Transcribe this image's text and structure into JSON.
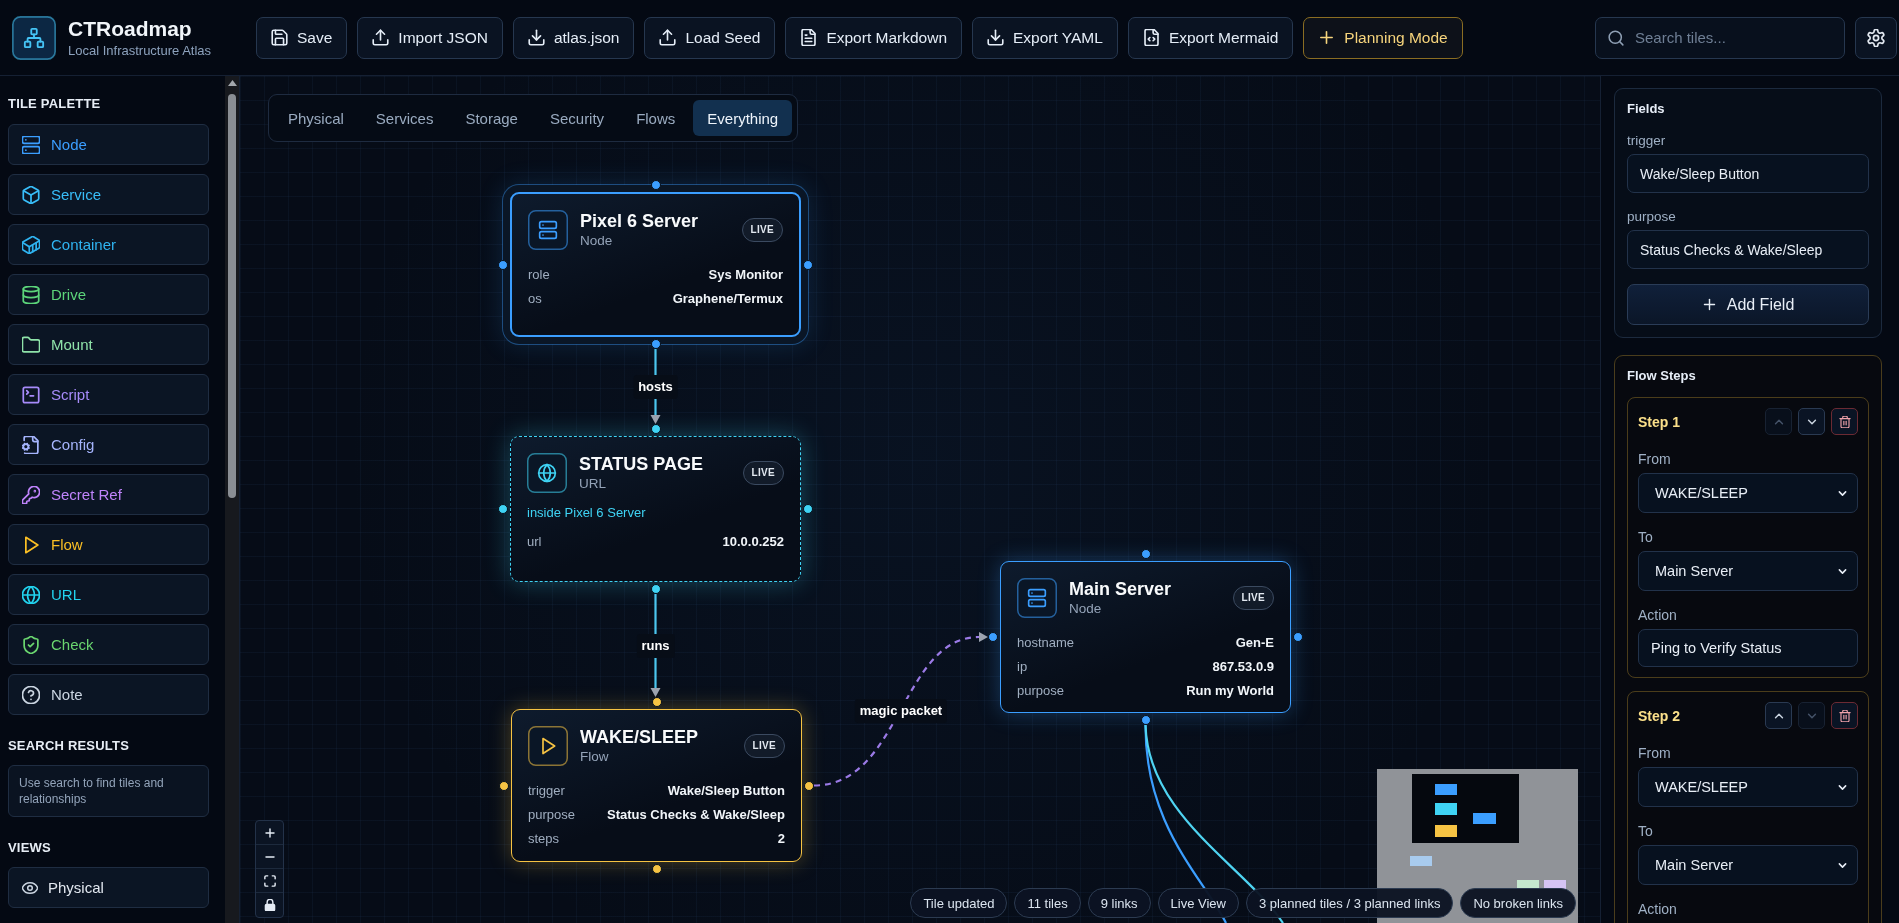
{
  "header": {
    "title": "CTRoadmap",
    "subtitle": "Local Infrastructure Atlas"
  },
  "toolbar": [
    {
      "label": "Save",
      "kind": "save",
      "highlighted": false
    },
    {
      "label": "Import JSON",
      "kind": "upload",
      "highlighted": false
    },
    {
      "label": "atlas.json",
      "kind": "download",
      "highlighted": false
    },
    {
      "label": "Load Seed",
      "kind": "upload",
      "highlighted": false
    },
    {
      "label": "Export Markdown",
      "kind": "document",
      "highlighted": false
    },
    {
      "label": "Export YAML",
      "kind": "download",
      "highlighted": false
    },
    {
      "label": "Export Mermaid",
      "kind": "code",
      "highlighted": false
    },
    {
      "label": "Planning Mode",
      "kind": "plus",
      "highlighted": true
    }
  ],
  "search": {
    "placeholder": "Search tiles..."
  },
  "sidebar": {
    "palette": {
      "title": "TILE PALETTE",
      "items": [
        {
          "label": "Node",
          "kind": "server",
          "color": "#3b9eff"
        },
        {
          "label": "Service",
          "kind": "cube",
          "color": "#38bdf8"
        },
        {
          "label": "Container",
          "kind": "container",
          "color": "#2fb3f0"
        },
        {
          "label": "Drive",
          "kind": "database",
          "color": "#5cd57a"
        },
        {
          "label": "Mount",
          "kind": "folder",
          "color": "#8fe3a9"
        },
        {
          "label": "Script",
          "kind": "terminal",
          "color": "#a78bfa"
        },
        {
          "label": "Config",
          "kind": "file-gear",
          "color": "#a5b4fc"
        },
        {
          "label": "Secret Ref",
          "kind": "key",
          "color": "#c084fc"
        },
        {
          "label": "Flow",
          "kind": "play",
          "color": "#fbbf24"
        },
        {
          "label": "URL",
          "kind": "globe",
          "color": "#22d3ee"
        },
        {
          "label": "Check",
          "kind": "shield-check",
          "color": "#6ad66f"
        },
        {
          "label": "Note",
          "kind": "help",
          "color": "#cbd5e1"
        }
      ]
    },
    "search_results": {
      "title": "SEARCH RESULTS",
      "hint": "Use search to find tiles and relationships"
    },
    "views": {
      "title": "VIEWS",
      "items": [
        {
          "label": "Physical",
          "kind": "eye"
        }
      ]
    }
  },
  "canvas": {
    "view_tabs": [
      {
        "label": "Physical",
        "selected": false
      },
      {
        "label": "Services",
        "selected": false
      },
      {
        "label": "Storage",
        "selected": false
      },
      {
        "label": "Security",
        "selected": false
      },
      {
        "label": "Flows",
        "selected": false
      },
      {
        "label": "Everything",
        "selected": true
      }
    ],
    "nodes": [
      {
        "kind": "node",
        "title": "Pixel 6 Server",
        "type": "Node",
        "badge": "LIVE",
        "color": "#3b9eff",
        "fields": [
          {
            "key": "role",
            "value": "Sys Monitor"
          },
          {
            "key": "os",
            "value": "Graphene/Termux"
          }
        ]
      },
      {
        "kind": "url",
        "title": "STATUS PAGE",
        "type": "URL",
        "badge": "LIVE",
        "color": "#3fd3f4",
        "parent": "inside Pixel 6 Server",
        "fields": [
          {
            "key": "url",
            "value": "10.0.0.252"
          }
        ]
      },
      {
        "kind": "flow",
        "title": "WAKE/SLEEP",
        "type": "Flow",
        "badge": "LIVE",
        "color": "#f6c343",
        "fields": [
          {
            "key": "trigger",
            "value": "Wake/Sleep Button"
          },
          {
            "key": "purpose",
            "value": "Status Checks & Wake/Sleep"
          },
          {
            "key": "steps",
            "value": "2"
          }
        ]
      },
      {
        "kind": "node",
        "title": "Main Server",
        "type": "Node",
        "badge": "LIVE",
        "color": "#3b9eff",
        "fields": [
          {
            "key": "hostname",
            "value": "Gen-E"
          },
          {
            "key": "ip",
            "value": "867.53.0.9"
          },
          {
            "key": "purpose",
            "value": "Run my World"
          }
        ]
      }
    ],
    "edge_labels": [
      "hosts",
      "runs",
      "magic packet"
    ],
    "status_bar": [
      "Tile updated",
      "11 tiles",
      "9 links",
      "Live View",
      "3 planned tiles / 3 planned links",
      "No broken links"
    ]
  },
  "inspector": {
    "fields": {
      "title": "Fields",
      "items": [
        {
          "label": "trigger",
          "value": "Wake/Sleep Button"
        },
        {
          "label": "purpose",
          "value": "Status Checks & Wake/Sleep"
        }
      ],
      "add_button": "Add Field"
    },
    "flow_steps": {
      "title": "Flow Steps",
      "steps": [
        {
          "title": "Step 1",
          "up_disabled": true,
          "down_disabled": false,
          "from_label": "From",
          "from": "WAKE/SLEEP",
          "to_label": "To",
          "to": "Main Server",
          "action_label": "Action",
          "action": "Ping to Verify Status"
        },
        {
          "title": "Step 2",
          "up_disabled": false,
          "down_disabled": true,
          "from_label": "From",
          "from": "WAKE/SLEEP",
          "to_label": "To",
          "to": "Main Server",
          "action_label": "Action"
        }
      ]
    }
  }
}
